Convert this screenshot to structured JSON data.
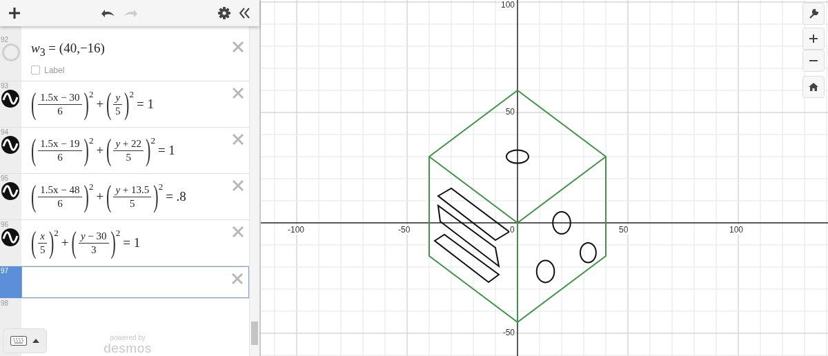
{
  "toolbar": {
    "redo_disabled": true
  },
  "expressions": [
    {
      "number": "92",
      "kind": "point",
      "latex": "*w*$_{3}$ = (40,−16)",
      "label_checkbox": {
        "text": "Label",
        "checked": false
      },
      "selected": false
    },
    {
      "number": "93",
      "kind": "curve",
      "selected": false,
      "parts": [
        {
          "kind": "group",
          "open": "(",
          "num": "1.5x − 30",
          "den": "6",
          "close": ")",
          "exp": "2"
        },
        {
          "kind": "op",
          "text": "+"
        },
        {
          "kind": "group",
          "open": "(",
          "num": "*y*",
          "den": "5",
          "close": ")",
          "exp": "2"
        },
        {
          "kind": "op",
          "text": "= 1"
        }
      ]
    },
    {
      "number": "94",
      "kind": "curve",
      "selected": false,
      "parts": [
        {
          "kind": "group",
          "open": "(",
          "num": "1.5x − 19",
          "den": "6",
          "close": ")",
          "exp": "2"
        },
        {
          "kind": "op",
          "text": "+"
        },
        {
          "kind": "group",
          "open": "(",
          "num": "*y* + 22",
          "den": "5",
          "close": ")",
          "exp": "2"
        },
        {
          "kind": "op",
          "text": "= 1"
        }
      ]
    },
    {
      "number": "95",
      "kind": "curve",
      "selected": false,
      "parts": [
        {
          "kind": "group",
          "open": "(",
          "num": "1.5x − 48",
          "den": "6",
          "close": ")",
          "exp": "2"
        },
        {
          "kind": "op",
          "text": "+"
        },
        {
          "kind": "group",
          "open": "(",
          "num": "*y* + 13.5",
          "den": "5",
          "close": ")",
          "exp": "2"
        },
        {
          "kind": "op",
          "text": "= .8"
        }
      ]
    },
    {
      "number": "96",
      "kind": "curve",
      "selected": false,
      "parts": [
        {
          "kind": "group",
          "open": "(",
          "num": "*x*",
          "den": "5",
          "close": ")",
          "exp": "2"
        },
        {
          "kind": "op",
          "text": "+"
        },
        {
          "kind": "group",
          "open": "(",
          "num": "*y* − 30",
          "den": "3",
          "close": ")",
          "exp": "2"
        },
        {
          "kind": "op",
          "text": "= 1"
        }
      ]
    },
    {
      "number": "97",
      "kind": "empty",
      "selected": true
    },
    {
      "number": "98",
      "kind": "new",
      "selected": false
    }
  ],
  "branding": {
    "line_1": "powered by",
    "line_2": "desmos"
  },
  "graph": {
    "x_tick_labels": [
      "-100",
      "-50",
      "0",
      "50",
      "100"
    ],
    "y_tick_labels": [
      "100",
      "50",
      "-50"
    ]
  }
}
